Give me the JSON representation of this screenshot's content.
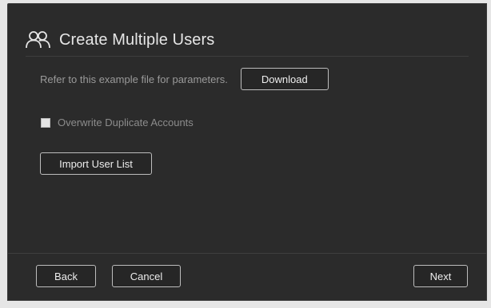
{
  "dialog": {
    "title": "Create Multiple Users",
    "title_icon": "users-icon"
  },
  "parameters": {
    "refer_text": "Refer to this example file for parameters.",
    "download_label": "Download"
  },
  "options": {
    "overwrite_label": "Overwrite Duplicate Accounts",
    "overwrite_checked": false
  },
  "import": {
    "import_label": "Import User List"
  },
  "footer": {
    "back_label": "Back",
    "cancel_label": "Cancel",
    "next_label": "Next"
  },
  "colors": {
    "dialog_background": "#2b2b2b",
    "title_text": "#e6e6e6",
    "muted_text": "#9a9a9a",
    "button_border": "#bdbdbd"
  }
}
